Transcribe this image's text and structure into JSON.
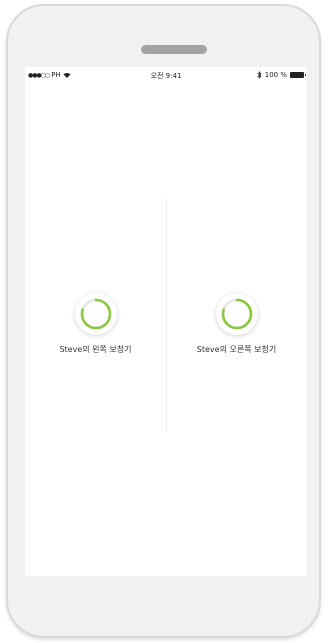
{
  "status_bar": {
    "signal_dots": "●●●○○",
    "carrier": "PH",
    "wifi_icon": "wifi-icon",
    "time": "오전 9:41",
    "bluetooth_icon": "bluetooth-icon",
    "battery": "100 %",
    "battery_icon": "battery-icon"
  },
  "devices": {
    "left": {
      "label": "Steve의 왼쪽 보청기",
      "progress": 0.8
    },
    "right": {
      "label": "Steve의 오른쪽 보청기",
      "progress": 0.8
    }
  },
  "colors": {
    "accent": "#8cc63f",
    "track": "#e6e6e6"
  }
}
